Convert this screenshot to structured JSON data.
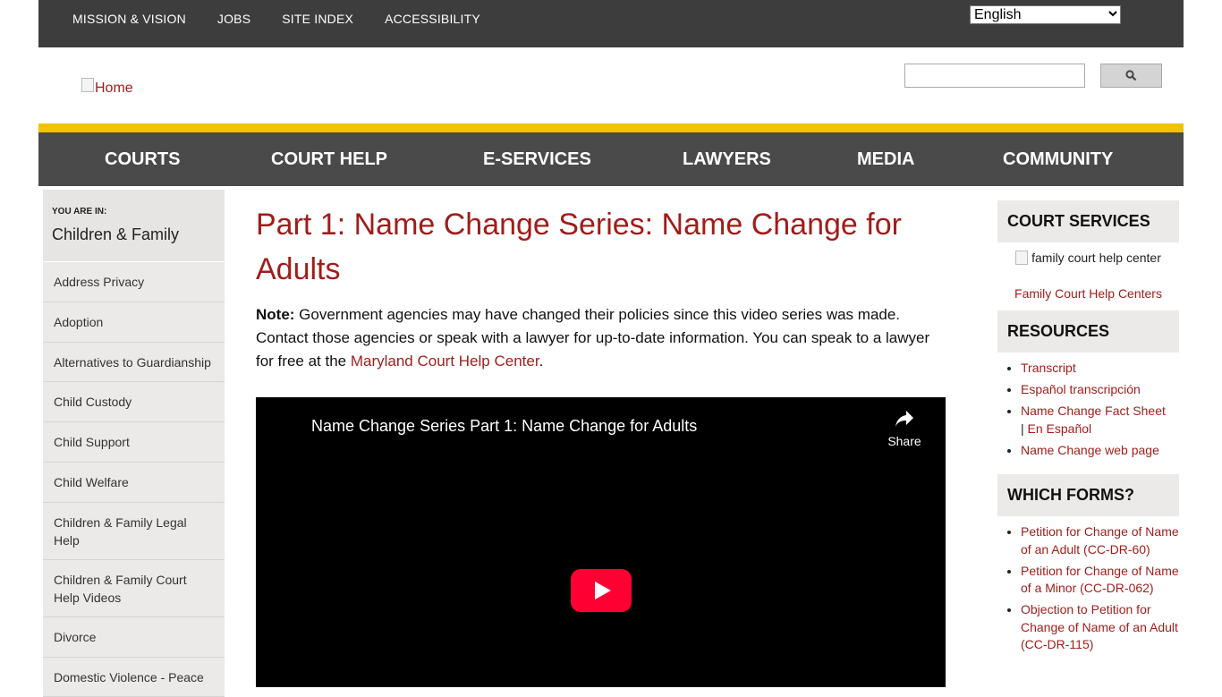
{
  "utility_nav": {
    "links": [
      "MISSION & VISION",
      "JOBS",
      "SITE INDEX",
      "ACCESSIBILITY"
    ],
    "language_select": "English"
  },
  "header": {
    "logo_alt": "Home"
  },
  "main_nav": [
    "COURTS",
    "COURT HELP",
    "E-SERVICES",
    "LAWYERS",
    "MEDIA",
    "COMMUNITY"
  ],
  "sidebar": {
    "you_are_in_label": "YOU ARE IN:",
    "current_section": "Children & Family",
    "items": [
      "Address Privacy",
      "Adoption",
      "Alternatives to Guardianship",
      "Child Custody",
      "Child Support",
      "Child Welfare",
      "Children & Family Legal Help",
      "Children & Family Court Help Videos",
      "Divorce",
      "Domestic Violence - Peace"
    ]
  },
  "content": {
    "title": "Part 1: Name Change Series: Name Change for Adults",
    "note_label": "Note:",
    "note_text": " Government agencies may have changed their policies since this video series was made. Contact those agencies or speak with a lawyer for up-to-date information. You can speak to a lawyer for free at the ",
    "note_link": "Maryland Court Help Center",
    "note_end": ".",
    "video": {
      "title": "Name Change Series Part 1: Name Change for Adults",
      "share_label": "Share",
      "accent": "#ff0033"
    }
  },
  "right_sidebar": {
    "court_services": {
      "heading": "COURT SERVICES",
      "image_alt": "family court help center",
      "link": "Family Court Help Centers"
    },
    "resources": {
      "heading": "RESOURCES",
      "items": [
        "Transcript",
        "Español transcripción",
        "Name Change Fact Sheet",
        "En Español",
        "Name Change web page"
      ],
      "separator": "|"
    },
    "which_forms": {
      "heading": "WHICH FORMS?",
      "items": [
        "Petition for Change of Name of an Adult (CC-DR-60)",
        "Petition for Change of Name of a Minor (CC-DR-062)",
        "Objection to Petition for Change of Name of an Adult (CC-DR-115)"
      ]
    }
  },
  "colors": {
    "utility_bg": "#3d3d3d",
    "nav_bg": "#4a4a4a",
    "gold": "#f2c200",
    "link": "#9f1d1a"
  }
}
